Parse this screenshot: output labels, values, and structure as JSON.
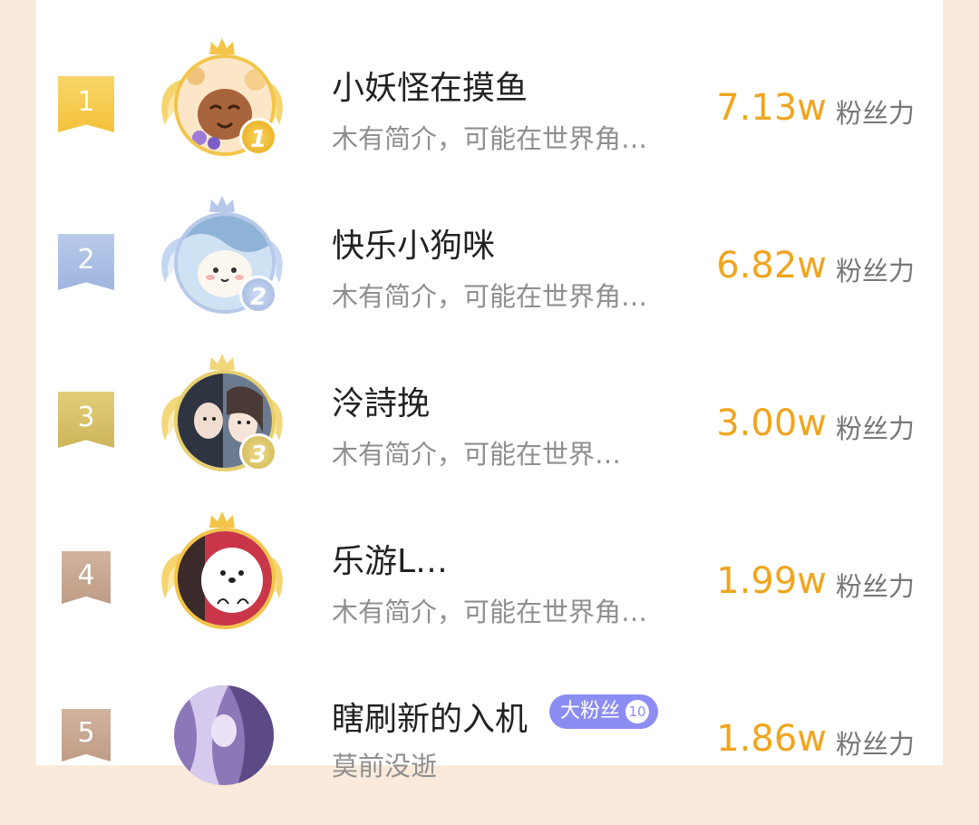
{
  "unit_label": "粉丝力",
  "rows": [
    {
      "rank": "1",
      "name": "小妖怪在摸鱼",
      "bio": "木有简介，可能在世界角…",
      "score": "7.13w",
      "medal": "1"
    },
    {
      "rank": "2",
      "name": "快乐小狗咪",
      "bio": "木有简介，可能在世界角…",
      "score": "6.82w",
      "medal": "2"
    },
    {
      "rank": "3",
      "name": "泠詩挽",
      "bio": "木有简介，可能在世界…",
      "score": "3.00w",
      "medal": "3"
    },
    {
      "rank": "4",
      "name": "乐游L…",
      "bio": "木有简介，可能在世界角…",
      "score": "1.99w"
    },
    {
      "rank": "5",
      "name": "瞎刷新的入机",
      "bio": "莫前没逝",
      "score": "1.86w",
      "badge": {
        "label": "大粉丝",
        "level": "10"
      }
    }
  ],
  "colors": {
    "score": "#f0a51f",
    "rank1": "#f6c94a",
    "rank2": "#a9bde3",
    "rank3": "#d8c16a",
    "rank4": "#c9a893",
    "badge": "#8c8df3"
  }
}
